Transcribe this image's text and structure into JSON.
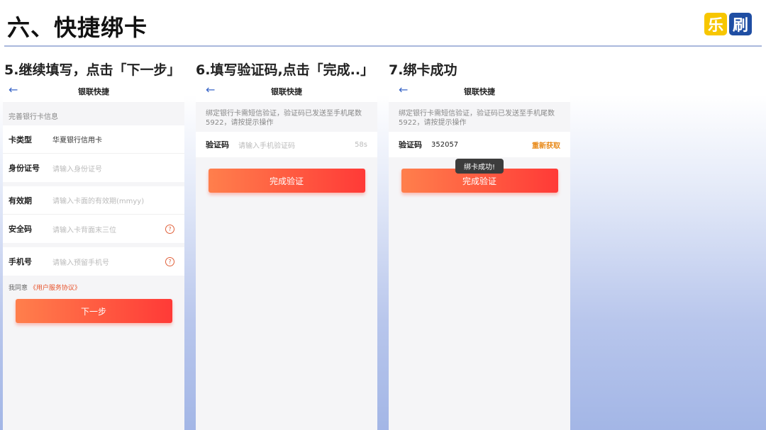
{
  "slide": {
    "title": "六、快捷绑卡",
    "logo": [
      "乐",
      "刷"
    ]
  },
  "steps": [
    {
      "label": "5.继续填写，点击「下一步」",
      "nav_title": "银联快捷",
      "section_label": "完善银行卡信息",
      "fields": [
        {
          "label": "卡类型",
          "value": "华夏银行信用卡"
        },
        {
          "label": "身份证号",
          "placeholder": "请输入身份证号"
        },
        {
          "label": "有效期",
          "placeholder": "请输入卡面的有效期(mmyy)"
        },
        {
          "label": "安全码",
          "placeholder": "请输入卡背面末三位"
        },
        {
          "label": "手机号",
          "placeholder": "请输入预留手机号"
        }
      ],
      "agree_text": "我同意",
      "agree_link": "《用户服务协议》",
      "button": "下一步"
    },
    {
      "label": "6.填写验证码,点击「完成..」",
      "nav_title": "银联快捷",
      "info": "绑定银行卡需短信验证，验证码已发送至手机尾数5922，请按提示操作",
      "code_label": "验证码",
      "code_placeholder": "请输入手机验证码",
      "countdown": "58s",
      "button": "完成验证"
    },
    {
      "label": "7.绑卡成功",
      "nav_title": "银联快捷",
      "info": "绑定银行卡需短信验证，验证码已发送至手机尾数5922，请按提示操作",
      "code_label": "验证码",
      "code_value": "352057",
      "resend": "重新获取",
      "toast": "绑卡成功!",
      "button": "完成验证"
    }
  ]
}
